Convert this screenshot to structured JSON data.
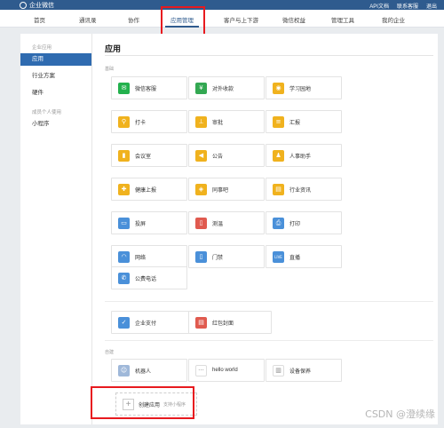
{
  "topbar": {
    "title": "企业微信",
    "links": [
      "API文档",
      "联系客服",
      "退出"
    ]
  },
  "nav": {
    "tabs": [
      "首页",
      "通讯录",
      "协作",
      "应用管理",
      "客户与上下游",
      "微信权益",
      "管理工具",
      "我的企业"
    ],
    "active": "应用管理"
  },
  "sidebar": {
    "group1": "企业应用",
    "items": [
      "应用",
      "行业方案",
      "硬件"
    ],
    "group2": "成员个人使用",
    "item_mini": "小程序"
  },
  "content": {
    "title": "应用",
    "section_base": "基础",
    "section_custom": "自建",
    "apps": [
      {
        "label": "微信客服",
        "color": "#23b14d",
        "icon": "chat-icon",
        "glyph": "✉"
      },
      {
        "label": "对外收款",
        "color": "#33a852",
        "icon": "payment-icon",
        "glyph": "¥"
      },
      {
        "label": "学习园地",
        "color": "#f0b21e",
        "icon": "study-icon",
        "glyph": "◉"
      },
      {
        "label": "打卡",
        "color": "#f0b21e",
        "icon": "location-icon",
        "glyph": "⚲"
      },
      {
        "label": "审批",
        "color": "#f0b21e",
        "icon": "stamp-icon",
        "glyph": "⊥"
      },
      {
        "label": "汇报",
        "color": "#f0b21e",
        "icon": "report-icon",
        "glyph": "≡"
      },
      {
        "label": "会议室",
        "color": "#f0b21e",
        "icon": "door-icon",
        "glyph": "▮"
      },
      {
        "label": "公告",
        "color": "#f0b21e",
        "icon": "megaphone-icon",
        "glyph": "◀"
      },
      {
        "label": "人事助手",
        "color": "#f0b21e",
        "icon": "person-icon",
        "glyph": "♟"
      },
      {
        "label": "健康上报",
        "color": "#f0b21e",
        "icon": "health-icon",
        "glyph": "✚"
      },
      {
        "label": "同事吧",
        "color": "#f0b21e",
        "icon": "community-icon",
        "glyph": "◈"
      },
      {
        "label": "行业资讯",
        "color": "#f0b21e",
        "icon": "news-icon",
        "glyph": "▤"
      },
      {
        "label": "投屏",
        "color": "#4a90d9",
        "icon": "cast-icon",
        "glyph": "▭"
      },
      {
        "label": "测温",
        "color": "#e05a4f",
        "icon": "thermometer-icon",
        "glyph": "▯"
      },
      {
        "label": "打印",
        "color": "#4a90d9",
        "icon": "printer-icon",
        "glyph": "⎙"
      },
      {
        "label": "网络",
        "color": "#4a90d9",
        "icon": "wifi-icon",
        "glyph": "◠"
      },
      {
        "label": "门禁",
        "color": "#4a90d9",
        "icon": "access-icon",
        "glyph": "▯"
      },
      {
        "label": "直播",
        "color": "#4a90d9",
        "icon": "live-icon",
        "glyph": "LIVE"
      },
      {
        "label": "公费电话",
        "color": "#4a90d9",
        "icon": "phone-icon",
        "glyph": "✆"
      },
      {
        "label": "企业支付",
        "color": "#4a90d9",
        "icon": "enterprise-pay-icon",
        "glyph": "✓"
      },
      {
        "label": "红包封面",
        "color": "#e05a4f",
        "icon": "redpacket-icon",
        "glyph": "▤"
      }
    ],
    "custom_apps": [
      {
        "label": "机器人",
        "color": "#9fb8d9",
        "icon": "robot-icon",
        "glyph": "☺"
      },
      {
        "label": "hello world",
        "color": "#ffffff",
        "icon": "dots-icon",
        "glyph": "···"
      },
      {
        "label": "设备保养",
        "color": "#ffffff",
        "icon": "barcode-icon",
        "glyph": "▥"
      }
    ],
    "create": {
      "label": "创建应用",
      "sub": "支持小程序",
      "plus": "+"
    }
  },
  "watermark": "CSDN @澄续缘"
}
